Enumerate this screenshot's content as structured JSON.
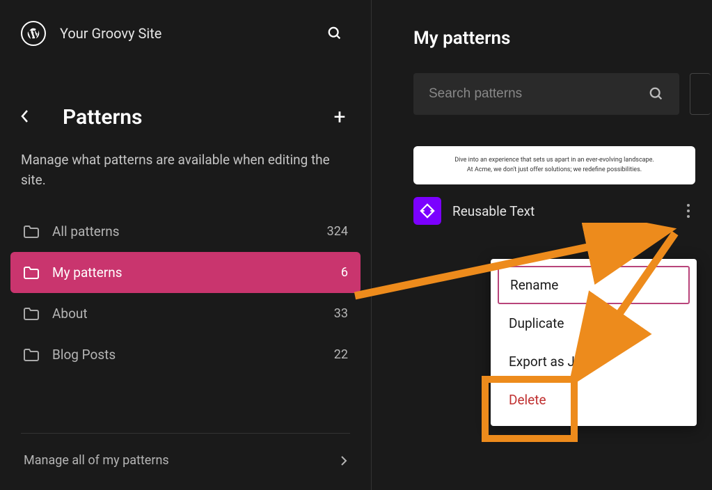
{
  "header": {
    "site_name": "Your Groovy Site"
  },
  "sidebar": {
    "title": "Patterns",
    "description": "Manage what patterns are available when editing the site.",
    "folders": [
      {
        "label": "All patterns",
        "count": "324",
        "active": false
      },
      {
        "label": "My patterns",
        "count": "6",
        "active": true
      },
      {
        "label": "About",
        "count": "33",
        "active": false
      },
      {
        "label": "Blog Posts",
        "count": "22",
        "active": false
      }
    ],
    "manage_link": "Manage all of my patterns"
  },
  "main": {
    "title": "My patterns",
    "search_placeholder": "Search patterns",
    "pattern": {
      "preview_line1": "Dive into an experience that sets us apart in an ever-evolving landscape.",
      "preview_line2": "At Acme, we don't just offer solutions; we redefine possibilities.",
      "name": "Reusable Text"
    }
  },
  "dropdown": {
    "items": [
      {
        "label": "Rename",
        "highlighted": true,
        "danger": false
      },
      {
        "label": "Duplicate",
        "highlighted": false,
        "danger": false
      },
      {
        "label": "Export as JSON",
        "highlighted": false,
        "danger": false
      },
      {
        "label": "Delete",
        "highlighted": false,
        "danger": true
      }
    ]
  }
}
